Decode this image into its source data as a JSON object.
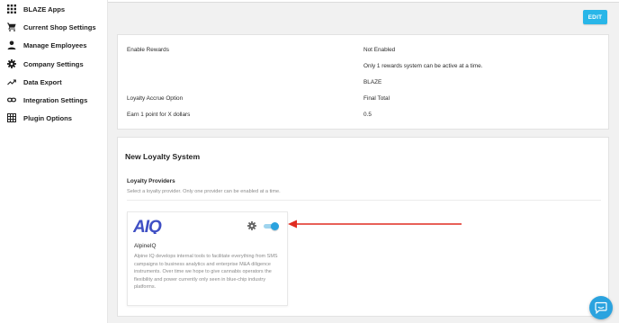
{
  "sidebar": {
    "items": [
      {
        "label": "BLAZE Apps",
        "icon": "apps-grid-icon"
      },
      {
        "label": "Current Shop Settings",
        "icon": "cart-icon"
      },
      {
        "label": "Manage Employees",
        "icon": "person-icon"
      },
      {
        "label": "Company Settings",
        "icon": "gear-icon"
      },
      {
        "label": "Data Export",
        "icon": "trending-icon"
      },
      {
        "label": "Integration Settings",
        "icon": "link-icon"
      },
      {
        "label": "Plugin Options",
        "icon": "grid-icon"
      }
    ]
  },
  "toolbar": {
    "edit_label": "EDIT"
  },
  "settings": {
    "rows": [
      {
        "label": "Enable Rewards",
        "value": "Not Enabled"
      },
      {
        "label": "",
        "value": "Only 1 rewards system can be active at a time."
      },
      {
        "label": "",
        "value": "BLAZE"
      },
      {
        "label": "Loyalty Accrue Option",
        "value": "Final Total"
      },
      {
        "label": "Earn 1 point for X dollars",
        "value": "0.5"
      }
    ]
  },
  "loyalty": {
    "title": "New Loyalty System",
    "providers_label": "Loyalty Providers",
    "providers_hint": "Select a loyalty provider. Only one provider can be enabled at a time.",
    "provider": {
      "logo_text": "AIQ",
      "name": "AlpineIQ",
      "description": "Alpine IQ develops internal tools to facilitate everything from SMS campaigns to business analytics and enterprise M&A diligence instruments. Over time we hope to give cannabis operators the flexibility and power currently only seen in blue-chip industry platforms.",
      "enabled": true
    }
  },
  "colors": {
    "accent": "#29b6e8",
    "toggle": "#2ba3df",
    "annotation_arrow": "#e02b20",
    "logo": "#3f4fc4"
  }
}
